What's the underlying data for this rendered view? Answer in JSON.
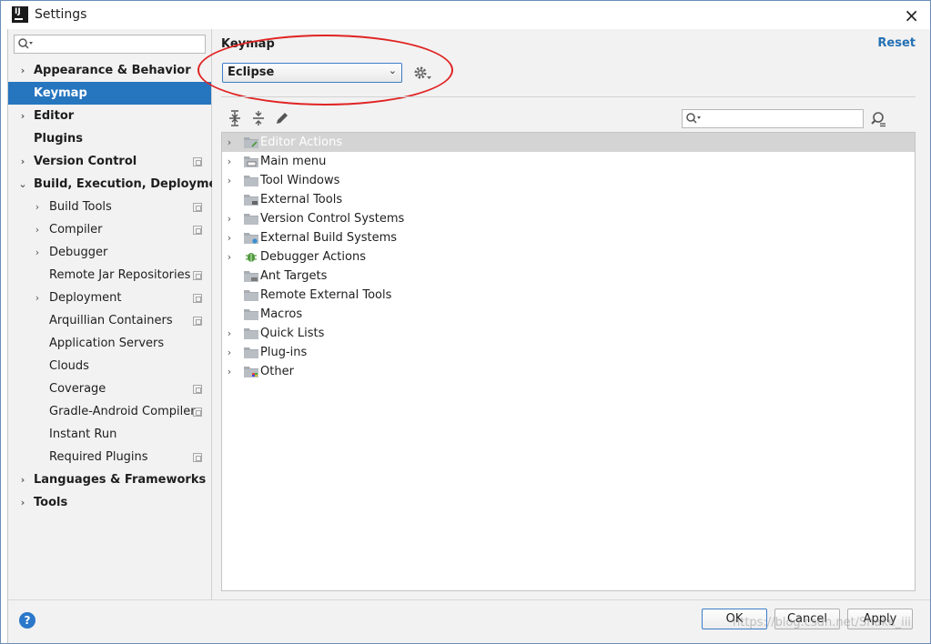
{
  "window": {
    "title": "Settings",
    "app_icon_text": "IJ",
    "close_glyph": "×"
  },
  "sidebar": {
    "search_placeholder": "",
    "items": [
      {
        "label": "Appearance & Behavior",
        "top": true,
        "arrow": "›",
        "level": 0
      },
      {
        "label": "Keymap",
        "top": true,
        "arrow": "",
        "level": 0,
        "selected": true
      },
      {
        "label": "Editor",
        "top": true,
        "arrow": "›",
        "level": 0
      },
      {
        "label": "Plugins",
        "top": true,
        "arrow": "",
        "level": 0
      },
      {
        "label": "Version Control",
        "top": true,
        "arrow": "›",
        "level": 0,
        "project": true
      },
      {
        "label": "Build, Execution, Deployment",
        "top": true,
        "arrow": "⌄",
        "level": 0
      },
      {
        "label": "Build Tools",
        "arrow": "›",
        "level": 1,
        "project": true
      },
      {
        "label": "Compiler",
        "arrow": "›",
        "level": 1,
        "project": true
      },
      {
        "label": "Debugger",
        "arrow": "›",
        "level": 1
      },
      {
        "label": "Remote Jar Repositories",
        "arrow": "",
        "level": 1,
        "project": true
      },
      {
        "label": "Deployment",
        "arrow": "›",
        "level": 1,
        "project": true
      },
      {
        "label": "Arquillian Containers",
        "arrow": "",
        "level": 1,
        "project": true
      },
      {
        "label": "Application Servers",
        "arrow": "",
        "level": 1
      },
      {
        "label": "Clouds",
        "arrow": "",
        "level": 1
      },
      {
        "label": "Coverage",
        "arrow": "",
        "level": 1,
        "project": true
      },
      {
        "label": "Gradle-Android Compiler",
        "arrow": "",
        "level": 1,
        "project": true
      },
      {
        "label": "Instant Run",
        "arrow": "",
        "level": 1
      },
      {
        "label": "Required Plugins",
        "arrow": "",
        "level": 1,
        "project": true
      },
      {
        "label": "Languages & Frameworks",
        "top": true,
        "arrow": "›",
        "level": 0
      },
      {
        "label": "Tools",
        "top": true,
        "arrow": "›",
        "level": 0
      }
    ]
  },
  "main": {
    "breadcrumb": "Keymap",
    "reset_label": "Reset",
    "keymap_value": "Eclipse",
    "dropdown_glyph": "⌄",
    "find_placeholder": "",
    "actions": [
      {
        "label": "Editor Actions",
        "arrow": "›",
        "icon": "editor",
        "highlight": true
      },
      {
        "label": "Main menu",
        "arrow": "›",
        "icon": "menu"
      },
      {
        "label": "Tool Windows",
        "arrow": "›",
        "icon": "folder"
      },
      {
        "label": "External Tools",
        "arrow": "",
        "icon": "tools"
      },
      {
        "label": "Version Control Systems",
        "arrow": "›",
        "icon": "folder"
      },
      {
        "label": "External Build Systems",
        "arrow": "›",
        "icon": "build"
      },
      {
        "label": "Debugger Actions",
        "arrow": "›",
        "icon": "bug"
      },
      {
        "label": "Ant Targets",
        "arrow": "",
        "icon": "ant"
      },
      {
        "label": "Remote External Tools",
        "arrow": "",
        "icon": "folder"
      },
      {
        "label": "Macros",
        "arrow": "",
        "icon": "folder"
      },
      {
        "label": "Quick Lists",
        "arrow": "›",
        "icon": "folder"
      },
      {
        "label": "Plug-ins",
        "arrow": "›",
        "icon": "folder"
      },
      {
        "label": "Other",
        "arrow": "›",
        "icon": "other"
      }
    ]
  },
  "footer": {
    "help_glyph": "?",
    "ok_label": "OK",
    "cancel_label": "Cancel",
    "apply_label": "Apply",
    "watermark": "https://blog.csdn.net/Shake_iii"
  },
  "colors": {
    "selection": "#2675bf",
    "accent_link": "#2470b3",
    "annotation_red": "#e02424"
  }
}
